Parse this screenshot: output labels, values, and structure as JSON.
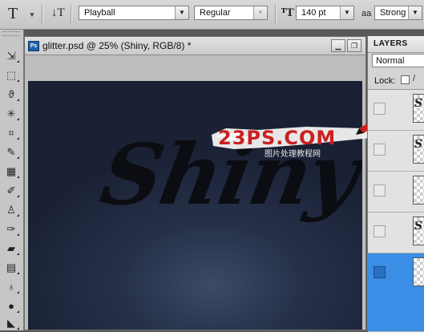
{
  "options_bar": {
    "tool_icon": "type-tool-icon",
    "orientation_icon": "text-orientation-icon",
    "font_family": "Playball",
    "font_style": "Regular",
    "size_icon": "font-size-icon",
    "font_size": "140 pt",
    "antialias_icon": "aa",
    "antialias": "Strong"
  },
  "toolbox": {
    "tools": [
      "move-tool-icon",
      "marquee-tool-icon",
      "lasso-tool-icon",
      "magic-wand-tool-icon",
      "crop-tool-icon",
      "eyedropper-tool-icon",
      "spot-healing-tool-icon",
      "brush-tool-icon",
      "clone-stamp-tool-icon",
      "history-brush-tool-icon",
      "eraser-tool-icon",
      "gradient-tool-icon",
      "blur-tool-icon",
      "dodge-tool-icon",
      "pen-tool-icon"
    ]
  },
  "document": {
    "title": "glitter.psd @ 25% (Shiny, RGB/8) *",
    "ps_badge": "Ps",
    "canvas_text": "Shiny",
    "watermark": {
      "main": "23PS.COM",
      "sub": "图片处理教程网"
    },
    "colors": {
      "canvas_dark": "#1a2135",
      "canvas_glow": "#3b4a66",
      "text": "#0b0d12"
    }
  },
  "layers_panel": {
    "tab": "LAYERS",
    "blend_mode": "Normal",
    "lock_label": "Lock:",
    "layers": [
      {
        "thumb_text": "S",
        "selected": false
      },
      {
        "thumb_text": "S",
        "selected": false
      },
      {
        "thumb_text": "",
        "selected": false
      },
      {
        "thumb_text": "S",
        "selected": false
      },
      {
        "thumb_text": "",
        "selected": true
      }
    ]
  }
}
